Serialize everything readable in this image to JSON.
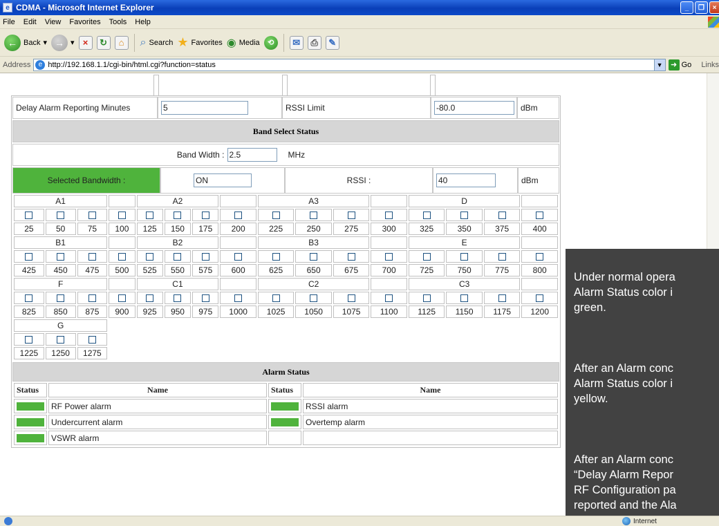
{
  "window": {
    "title": "CDMA - Microsoft Internet Explorer"
  },
  "menu": [
    "File",
    "Edit",
    "View",
    "Favorites",
    "Tools",
    "Help"
  ],
  "toolbar": {
    "back": "Back",
    "search": "Search",
    "favorites": "Favorites",
    "media": "Media"
  },
  "address": {
    "label": "Address",
    "url": "http://192.168.1.1/cgi-bin/html.cgi?function=status",
    "go": "Go",
    "links": "Links"
  },
  "settings": {
    "delay_label": "Delay Alarm Reporting Minutes",
    "delay_value": "5",
    "rssi_limit_label": "RSSI Limit",
    "rssi_limit_value": "-80.0",
    "rssi_limit_unit": "dBm"
  },
  "band_select": {
    "title": "Band Select Status",
    "bandwidth_label": "Band Width :",
    "bandwidth_value": "2.5",
    "bandwidth_unit": "MHz",
    "selected_label": "Selected Bandwidth :",
    "selected_value": "ON",
    "rssi_label": "RSSI :",
    "rssi_value": "40",
    "rssi_unit": "dBm",
    "status_color": "#4fb33c"
  },
  "bands": {
    "row1_headers": [
      "A1",
      "",
      "A2",
      "",
      "A3",
      "",
      "D",
      ""
    ],
    "row1_values": [
      "25",
      "50",
      "75",
      "100",
      "125",
      "150",
      "175",
      "200",
      "225",
      "250",
      "275",
      "300",
      "325",
      "350",
      "375",
      "400"
    ],
    "row2_headers": [
      "B1",
      "",
      "B2",
      "",
      "B3",
      "",
      "E",
      ""
    ],
    "row2_values": [
      "425",
      "450",
      "475",
      "500",
      "525",
      "550",
      "575",
      "600",
      "625",
      "650",
      "675",
      "700",
      "725",
      "750",
      "775",
      "800"
    ],
    "row3_headers": [
      "F",
      "",
      "C1",
      "",
      "C2",
      "",
      "C3",
      ""
    ],
    "row3_values": [
      "825",
      "850",
      "875",
      "900",
      "925",
      "950",
      "975",
      "1000",
      "1025",
      "1050",
      "1075",
      "1100",
      "1125",
      "1150",
      "1175",
      "1200"
    ],
    "row4_headers": [
      "G"
    ],
    "row4_values": [
      "1225",
      "1250",
      "1275"
    ]
  },
  "alarm_status": {
    "title": "Alarm Status",
    "col_status": "Status",
    "col_name": "Name",
    "left": [
      "RF Power alarm",
      "Undercurrent alarm",
      "VSWR alarm"
    ],
    "right": [
      "RSSI alarm",
      "Overtemp alarm",
      ""
    ],
    "ok_color": "#4fb33c"
  },
  "note": {
    "p1": "Under normal opera\nAlarm Status color i\ngreen.",
    "p2": "After an Alarm conc\nAlarm Status color i\nyellow.",
    "p3": "After an Alarm conc\n“Delay Alarm Repor\nRF Configuration pa\nreported and the Ala\nStatus page will be"
  },
  "statusbar": {
    "zone": "Internet"
  }
}
